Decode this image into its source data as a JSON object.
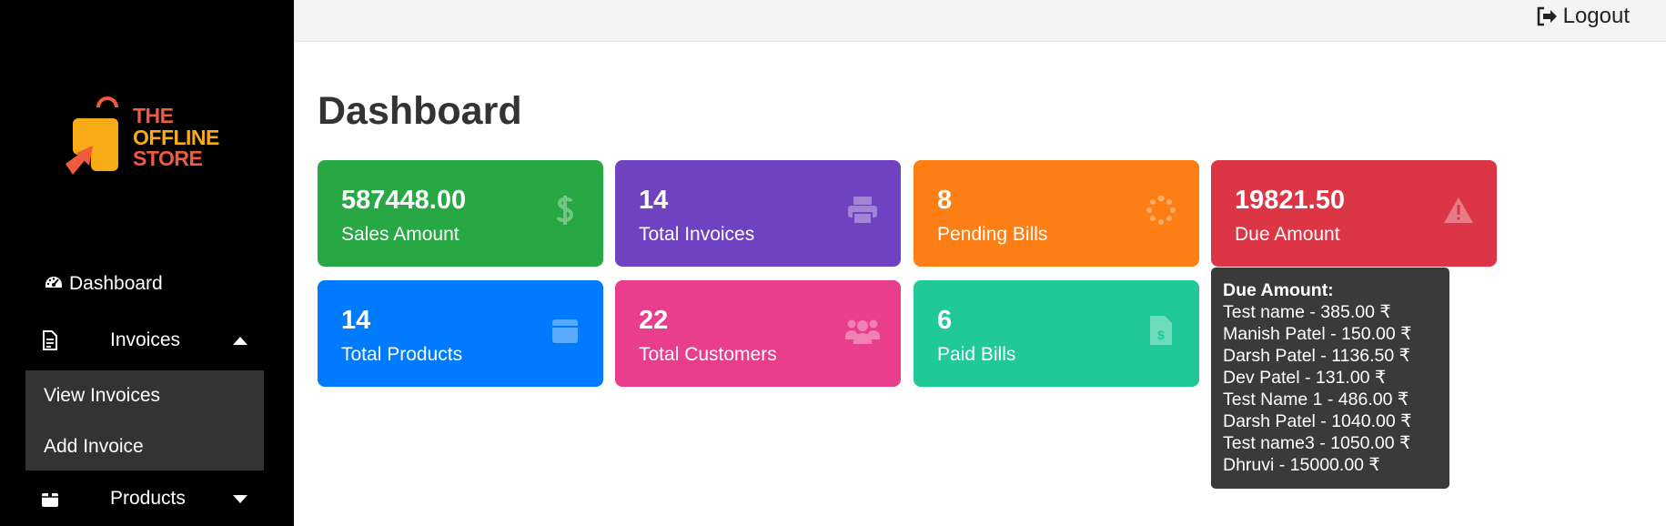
{
  "brand": {
    "logo_alt": "logo-icon",
    "line1": "THE",
    "line2": "OFFLINE",
    "line3": "STORE",
    "colors": {
      "orange": "#ef5b3b",
      "yellow": "#f6ab17"
    }
  },
  "sidebar": {
    "dashboard_label": "Dashboard",
    "invoices_label": "Invoices",
    "invoices_sub": {
      "view": "View Invoices",
      "add": "Add Invoice"
    },
    "products_label": "Products"
  },
  "topbar": {
    "logout_label": "Logout"
  },
  "page": {
    "title": "Dashboard"
  },
  "cards": [
    {
      "value": "587448.00",
      "label": "Sales Amount",
      "color": "#28a745",
      "icon": "dollar-icon"
    },
    {
      "value": "14",
      "label": "Total Invoices",
      "color": "#6f42c1",
      "icon": "printer-icon"
    },
    {
      "value": "8",
      "label": "Pending Bills",
      "color": "#fd7e14",
      "icon": "spinner-icon"
    },
    {
      "value": "19821.50",
      "label": "Due Amount",
      "color": "#dc3545",
      "icon": "warning-icon"
    },
    {
      "value": "14",
      "label": "Total Products",
      "color": "#007bff",
      "icon": "box-icon"
    },
    {
      "value": "22",
      "label": "Total Customers",
      "color": "#e83e8c",
      "icon": "users-icon"
    },
    {
      "value": "6",
      "label": "Paid Bills",
      "color": "#20c997",
      "icon": "invoice-dollar-icon"
    }
  ],
  "tooltip": {
    "title": "Due Amount:",
    "lines": [
      "Test name - 385.00 ₹",
      "Manish Patel - 150.00 ₹",
      "Darsh Patel - 1136.50 ₹",
      "Dev Patel - 131.00 ₹",
      "Test Name 1 - 486.00 ₹",
      "Darsh Patel - 1040.00 ₹",
      "Test name3 - 1050.00 ₹",
      "Dhruvi - 15000.00 ₹"
    ]
  }
}
